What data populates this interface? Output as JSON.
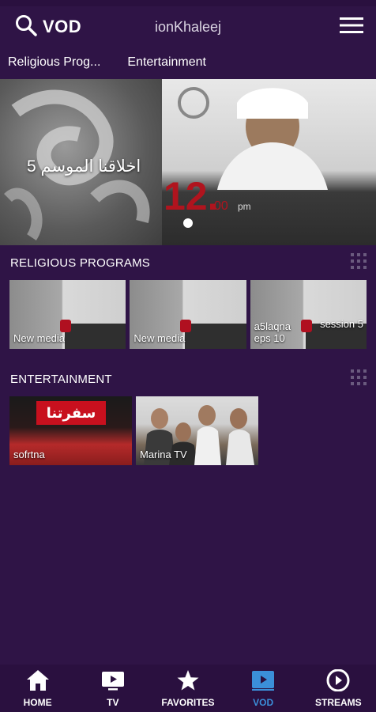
{
  "header": {
    "search_label": "VOD",
    "brand": "ionKhaleej"
  },
  "tabs": [
    {
      "label": "Religious Prog..."
    },
    {
      "label": "Entertainment"
    }
  ],
  "hero": {
    "title": "اخلاقنا الموسم 5",
    "slide_count": 1,
    "active_slide": 1
  },
  "sections": [
    {
      "title": "RELIGIOUS PROGRAMS",
      "items": [
        {
          "label": "New media",
          "label2": ""
        },
        {
          "label": "New media",
          "label2": ""
        },
        {
          "label": "a5laqna\neps 10",
          "label2": "session 5"
        }
      ]
    },
    {
      "title": "ENTERTAINMENT",
      "items": [
        {
          "label": "sofrtna",
          "logo_text": "سفرتنا"
        },
        {
          "label": "Marina TV"
        }
      ]
    }
  ],
  "bottom_nav": {
    "active": "VOD",
    "active_color": "#3b8fd9",
    "items": [
      {
        "label": "HOME",
        "icon": "home-icon"
      },
      {
        "label": "TV",
        "icon": "tv-icon"
      },
      {
        "label": "FAVORITES",
        "icon": "star-icon"
      },
      {
        "label": "VOD",
        "icon": "vod-icon"
      },
      {
        "label": "STREAMS",
        "icon": "play-circle-icon"
      }
    ]
  },
  "colors": {
    "background": "#2f1446",
    "nav_background": "#2a103f",
    "accent": "#3b8fd9"
  }
}
